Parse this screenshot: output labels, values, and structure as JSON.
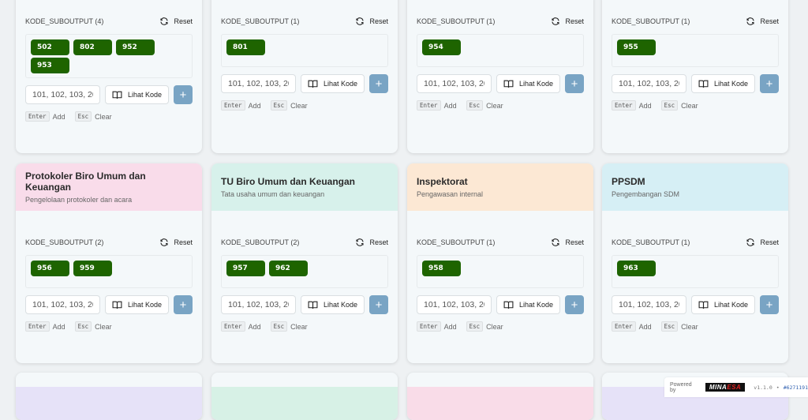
{
  "common": {
    "reset_label": "Reset",
    "lihat_label": "Lihat Kode",
    "plus_label": "+",
    "input_value": "101, 102, 103, 20",
    "enter_key": "Enter",
    "add_label": "Add",
    "esc_key": "Esc",
    "clear_label": "Clear"
  },
  "top_cards": [
    {
      "kode_label": "KODE_SUBOUTPUT (4)",
      "codes": [
        "502",
        "802",
        "952",
        "953"
      ]
    },
    {
      "kode_label": "KODE_SUBOUTPUT (1)",
      "codes": [
        "801"
      ]
    },
    {
      "kode_label": "KODE_SUBOUTPUT (1)",
      "codes": [
        "954"
      ]
    },
    {
      "kode_label": "KODE_SUBOUTPUT (1)",
      "codes": [
        "955"
      ]
    }
  ],
  "mid_cards": [
    {
      "title": "Protokoler Biro Umum dan Keuangan",
      "subtitle": "Pengelolaan protokoler dan acara",
      "header_color": "#f9dcea",
      "kode_label": "KODE_SUBOUTPUT (2)",
      "codes": [
        "956",
        "959"
      ]
    },
    {
      "title": "TU Biro Umum dan Keuangan",
      "subtitle": "Tata usaha umum dan keuangan",
      "header_color": "#d7f1eb",
      "kode_label": "KODE_SUBOUTPUT (2)",
      "codes": [
        "957",
        "962"
      ]
    },
    {
      "title": "Inspektorat",
      "subtitle": "Pengawasan internal",
      "header_color": "#fce8d4",
      "kode_label": "KODE_SUBOUTPUT (1)",
      "codes": [
        "958"
      ]
    },
    {
      "title": "PPSDM",
      "subtitle": "Pengembangan SDM",
      "header_color": "#d6eff5",
      "kode_label": "KODE_SUBOUTPUT (1)",
      "codes": [
        "963"
      ]
    }
  ],
  "bottom_cards": [
    {
      "header_color": "#e6e2f8"
    },
    {
      "header_color": "#d7f1e6"
    },
    {
      "header_color": "#f9dce8"
    },
    {
      "header_color": "#e6e2f8"
    }
  ],
  "footer": {
    "powered_by": "Powered by",
    "logo_main": "MINA",
    "logo_accent": "ESA",
    "version": "v1.1.0",
    "separator": "•",
    "build": "#6271191"
  }
}
